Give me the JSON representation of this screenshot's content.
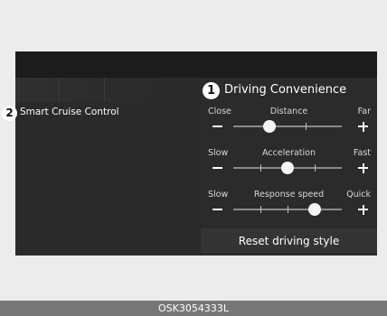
{
  "left_label": {
    "number": "2",
    "text": "Smart Cruise Control"
  },
  "panel": {
    "number": "1",
    "title": "Driving Convenience",
    "sliders": [
      {
        "left": "Close",
        "label": "Distance",
        "right": "Far",
        "minus": "−",
        "plus": "+",
        "level": 0.33
      },
      {
        "left": "Slow",
        "label": "Acceleration",
        "right": "Fast",
        "minus": "−",
        "plus": "+",
        "level": 0.5
      },
      {
        "left": "Slow",
        "label": "Response speed",
        "right": "Quick",
        "minus": "−",
        "plus": "+",
        "level": 0.75
      }
    ],
    "reset_label": "Reset driving style"
  },
  "caption": "OSK3054333L"
}
